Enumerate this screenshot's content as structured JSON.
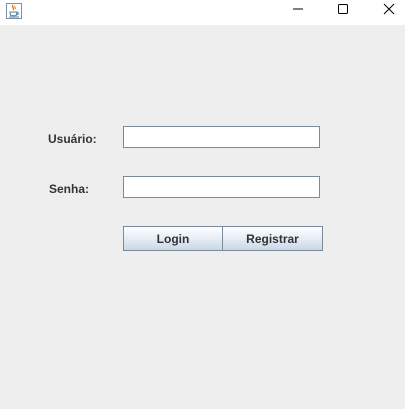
{
  "titlebar": {
    "app_icon": "java-cup-icon",
    "controls": [
      "minimize-icon",
      "maximize-icon",
      "close-icon"
    ]
  },
  "form": {
    "username_label": "Usuário:",
    "username_value": "",
    "password_label": "Senha:",
    "password_value": ""
  },
  "buttons": {
    "login_label": "Login",
    "register_label": "Registrar"
  },
  "colors": {
    "window_bg": "#eeeeee",
    "titlebar_bg": "#ffffff",
    "button_border": "#7a8a99"
  }
}
